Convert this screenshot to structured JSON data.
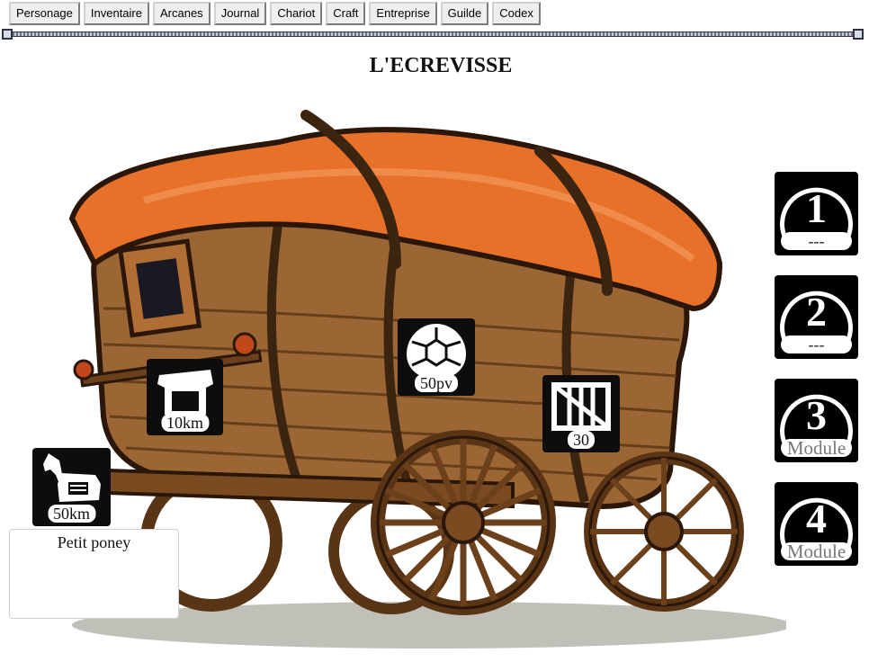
{
  "tabs": [
    "Personage",
    "Inventaire",
    "Arcanes",
    "Journal",
    "Chariot",
    "Craft",
    "Entreprise",
    "Guilde",
    "Codex"
  ],
  "title": "L'ECREVISSE",
  "stats": {
    "speed": "10km",
    "hp": "50pv",
    "cargo": "30",
    "mount_speed": "50km"
  },
  "mount_name": "Petit poney",
  "modules": [
    {
      "number": "1",
      "label": "---"
    },
    {
      "number": "2",
      "label": "---"
    },
    {
      "number": "3",
      "label": "Module"
    },
    {
      "number": "4",
      "label": "Module"
    }
  ],
  "colors": {
    "canvas": "#e8712a",
    "wood": "#8a5a2b",
    "wood_dark": "#5a3515",
    "badge": "#0d0d0d"
  },
  "icons": {
    "speed": "wagon-wheel-icon",
    "hp": "turtle-shell-icon",
    "cargo": "crate-icon",
    "mount": "pony-icon"
  }
}
